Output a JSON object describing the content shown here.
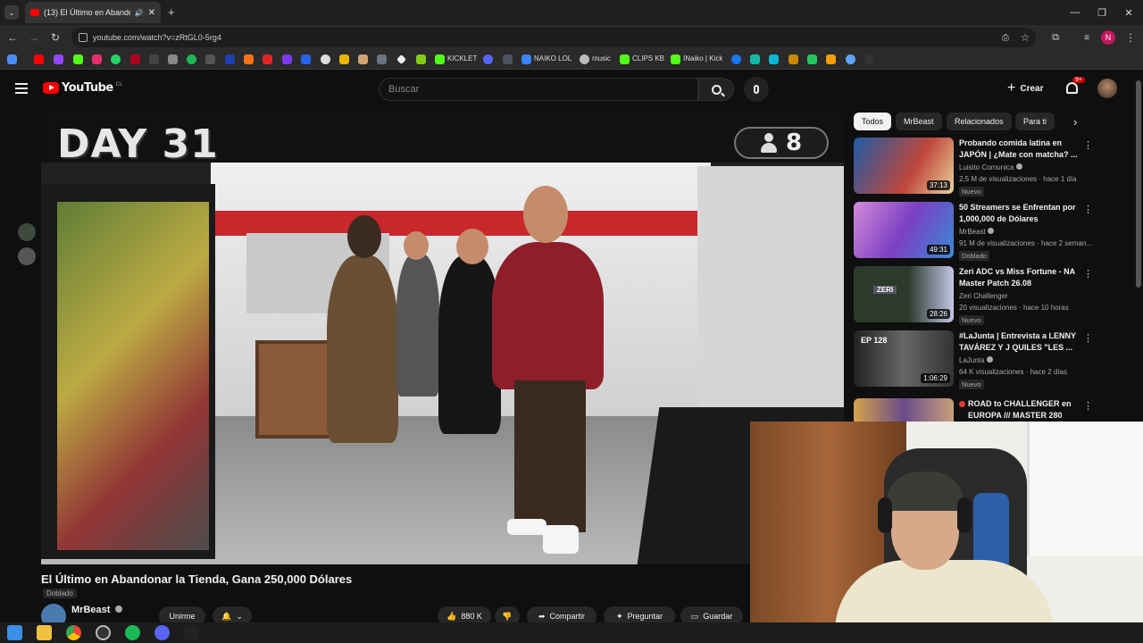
{
  "browser": {
    "tab_title": "(13) El Último en Abandonar",
    "url": "youtube.com/watch?v=zRtGL0-5rg4",
    "profile_initial": "N",
    "bookmarks": [
      "KICKLET",
      "NAIKO LOL",
      "music",
      "CLIPS KB",
      "INaiko | Kick"
    ]
  },
  "header": {
    "logo_text": "YouTube",
    "logo_region": "CL",
    "search_placeholder": "Buscar",
    "create_label": "Crear",
    "notif_count": "9+"
  },
  "video": {
    "overlay_day": "DAY 31",
    "overlay_count": "8",
    "title": "El Último en Abandonar la Tienda, Gana 250,000 Dólares",
    "dub_badge": "Doblado",
    "channel": "MrBeast",
    "join_label": "Unirme",
    "likes": "880 K",
    "share_label": "Compartir",
    "ask_label": "Preguntar",
    "save_label": "Guardar"
  },
  "chips": [
    "Todos",
    "MrBeast",
    "Relacionados",
    "Para ti"
  ],
  "recommendations": [
    {
      "title": "Probando comida latina en JAPÓN | ¿Mate con matcha? ...",
      "channel": "Luisito Comunica",
      "meta": "2,5 M de visualizaciones · hace 1 día",
      "badge": "Nuevo",
      "duration": "37:13",
      "thumb_color": "#c0473a"
    },
    {
      "title": "50 Streamers se Enfrentan por 1,000,000 de Dólares",
      "channel": "MrBeast",
      "meta": "91 M de visualizaciones · hace 2 seman...",
      "badge": "Doblado",
      "duration": "49:31",
      "thumb_color": "#7b3fc4"
    },
    {
      "title": "Zeri ADC vs Miss Fortune - NA Master Patch 26.08",
      "channel": "Zeri Challenger",
      "meta": "20 visualizaciones · hace 10 horas",
      "badge": "Nuevo",
      "duration": "28:26",
      "thumb_color": "#4b6a8a",
      "thumb_text": "ZERI"
    },
    {
      "title": "#LaJunta | Entrevista a LENNY TAVÁREZ Y J QUILES \"LES ...",
      "channel": "LaJunta",
      "meta": "64 K visualizaciones · hace 2 días",
      "badge": "Nuevo",
      "duration": "1:06:29",
      "thumb_color": "#3a3a3a",
      "thumb_text": "EP 128"
    },
    {
      "title": "ROAD to CHALLENGER en EUROPA /// MASTER 280 LPS ...",
      "channel": "",
      "meta": "",
      "badge": "",
      "duration": "",
      "thumb_color": "#6a4b8a"
    }
  ]
}
